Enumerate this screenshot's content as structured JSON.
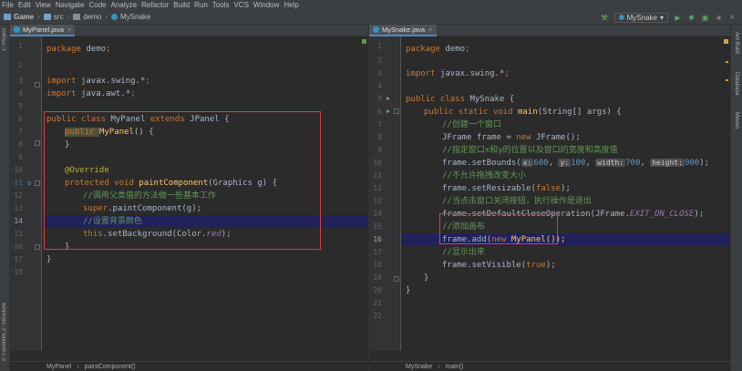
{
  "menu": [
    "File",
    "Edit",
    "View",
    "Navigate",
    "Code",
    "Analyze",
    "Refactor",
    "Build",
    "Run",
    "Tools",
    "VCS",
    "Window",
    "Help"
  ],
  "breadcrumb": [
    {
      "label": "Game",
      "icon": "folder-icon"
    },
    {
      "label": "src",
      "icon": "folder-icon"
    },
    {
      "label": "demo",
      "icon": "package-icon"
    },
    {
      "label": "MySnake",
      "icon": "class-icon"
    }
  ],
  "toolbar": {
    "run_config": "MySnake"
  },
  "left_sidebar": {
    "project": "1: Project",
    "structure": "Z: Structure",
    "favorites": "2: Favorites"
  },
  "right_sidebar": {
    "ant": "Ant Build",
    "database": "Database",
    "maven": "Maven"
  },
  "left_editor": {
    "tab": "MyPanel.java",
    "lines": [
      "1",
      "2",
      "3",
      "4",
      "5",
      "6",
      "7",
      "8",
      "9",
      "10",
      "11",
      "12",
      "13",
      "14",
      "15",
      "16",
      "17",
      "18"
    ],
    "code": {
      "l1a": "package ",
      "l1b": "demo",
      "l3a": "import ",
      "l3b": "javax.swing.*",
      "l4a": "import ",
      "l4b": "java.awt.*",
      "l6a": "public class ",
      "l6b": "MyPanel ",
      "l6c": "extends ",
      "l6d": "JPanel {",
      "l7a": "public ",
      "l7b": "MyPanel",
      "l7c": "() {",
      "l8": "}",
      "l10": "@Override",
      "l11a": "protected void ",
      "l11b": "paintComponent",
      "l11c": "(Graphics g) {",
      "l12": "//调用父类值的方法做一些基本工作",
      "l13a": "super",
      "l13b": ".paintComponent(g);",
      "l14": "//设置背景颜色",
      "l15a": "this",
      "l15b": ".setBackground(Color.",
      "l15c": "red",
      "l15d": ");",
      "l16": "}",
      "l17": "}"
    },
    "status": [
      "MyPanel",
      "paintComponent()"
    ]
  },
  "right_editor": {
    "tab": "MySnake.java",
    "lines": [
      "1",
      "2",
      "3",
      "4",
      "5",
      "6",
      "7",
      "8",
      "9",
      "10",
      "11",
      "12",
      "13",
      "14",
      "15",
      "16",
      "17",
      "18",
      "19",
      "20",
      "21",
      "22"
    ],
    "code": {
      "l1a": "package ",
      "l1b": "demo",
      "l3a": "import ",
      "l3b": "javax.swing.*",
      "l5a": "public class ",
      "l5b": "MySnake {",
      "l6a": "public static void ",
      "l6b": "main",
      "l6c": "(String[] args) {",
      "l7": "//创建一个窗口",
      "l8a": "JFrame frame = ",
      "l8b": "new ",
      "l8c": "JFrame();",
      "l9": "//指定窗口x和y的位置以及窗口的宽度和高度值",
      "l10a": "frame.setBounds(",
      "h_x": "x:",
      "v_x": "600",
      "h_y": "y:",
      "v_y": "100",
      "h_w": "width:",
      "v_w": "700",
      "h_h": "height:",
      "v_h": "900",
      "l10z": ");",
      "l11": "//不允许拖拽改变大小",
      "l12a": "frame.setResizable(",
      "l12b": "false",
      "l12c": ");",
      "l13": "//当点击窗口关闭按钮，执行操作是退出",
      "l14a": "frame.setDefaultCloseOperation(JFrame.",
      "l14b": "EXIT_ON_CLOSE",
      "l14c": ");",
      "l15": "//添加画布",
      "l16a": "frame.add(",
      "l16b": "new ",
      "l16c": "MyPanel());",
      "l17": "//显示出来",
      "l18a": "frame.setVisible(",
      "l18b": "true",
      "l18c": ");",
      "l19": "}",
      "l20": "}"
    },
    "status": [
      "MySnake",
      "main()"
    ]
  },
  "colors": {
    "accent": "#4a88c7",
    "highlight": "#21225a",
    "annotation_box": "#e03c3c"
  }
}
